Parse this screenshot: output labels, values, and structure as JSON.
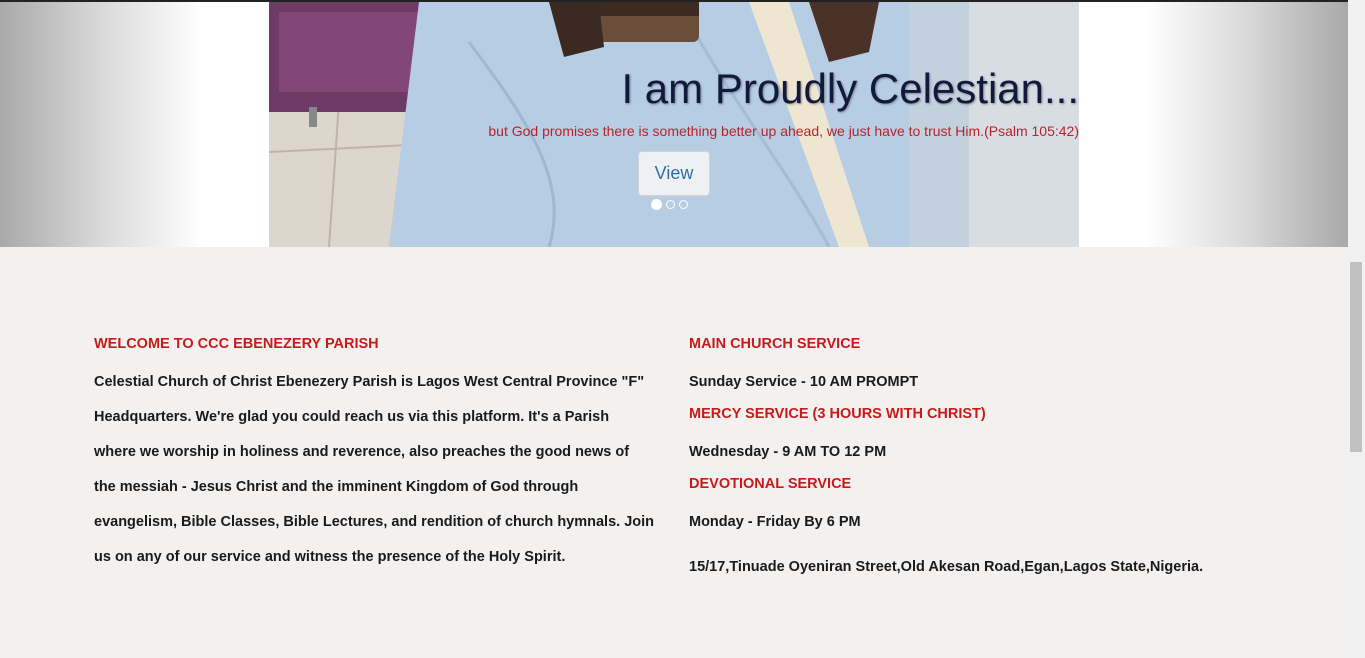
{
  "hero": {
    "title": "I am Proudly Celestian...",
    "subtitle": "but God promises there is something better up ahead, we just have to trust Him.(Psalm 105:42)",
    "button_label": "View",
    "slide_count": 3,
    "active_slide": 1
  },
  "welcome": {
    "heading": "WELCOME TO CCC EBENEZERY PARISH",
    "body": "Celestial Church of Christ Ebenezery Parish is Lagos West Central Province \"F\" Headquarters. We're glad you could reach us via this platform. It's a Parish where we worship in holiness and reverence, also preaches the good news of the messiah - Jesus Christ and the imminent Kingdom of God through evangelism, Bible Classes, Bible Lectures, and rendition of church hymnals. Join us on any of our service and witness the presence of the Holy Spirit."
  },
  "services": [
    {
      "heading": "MAIN CHURCH SERVICE",
      "time": "Sunday Service - 10 AM PROMPT"
    },
    {
      "heading": "MERCY SERVICE (3 HOURS WITH CHRIST)",
      "time": "Wednesday - 9 AM TO 12 PM"
    },
    {
      "heading": "DEVOTIONAL SERVICE",
      "time": "Monday - Friday By 6 PM"
    }
  ],
  "address": "15/17,Tinuade Oyeniran Street,Old Akesan Road,Egan,Lagos State,Nigeria.",
  "colors": {
    "accent_red": "#c81a1a",
    "page_bg": "#f3f1f0",
    "hero_title": "#13193c"
  }
}
